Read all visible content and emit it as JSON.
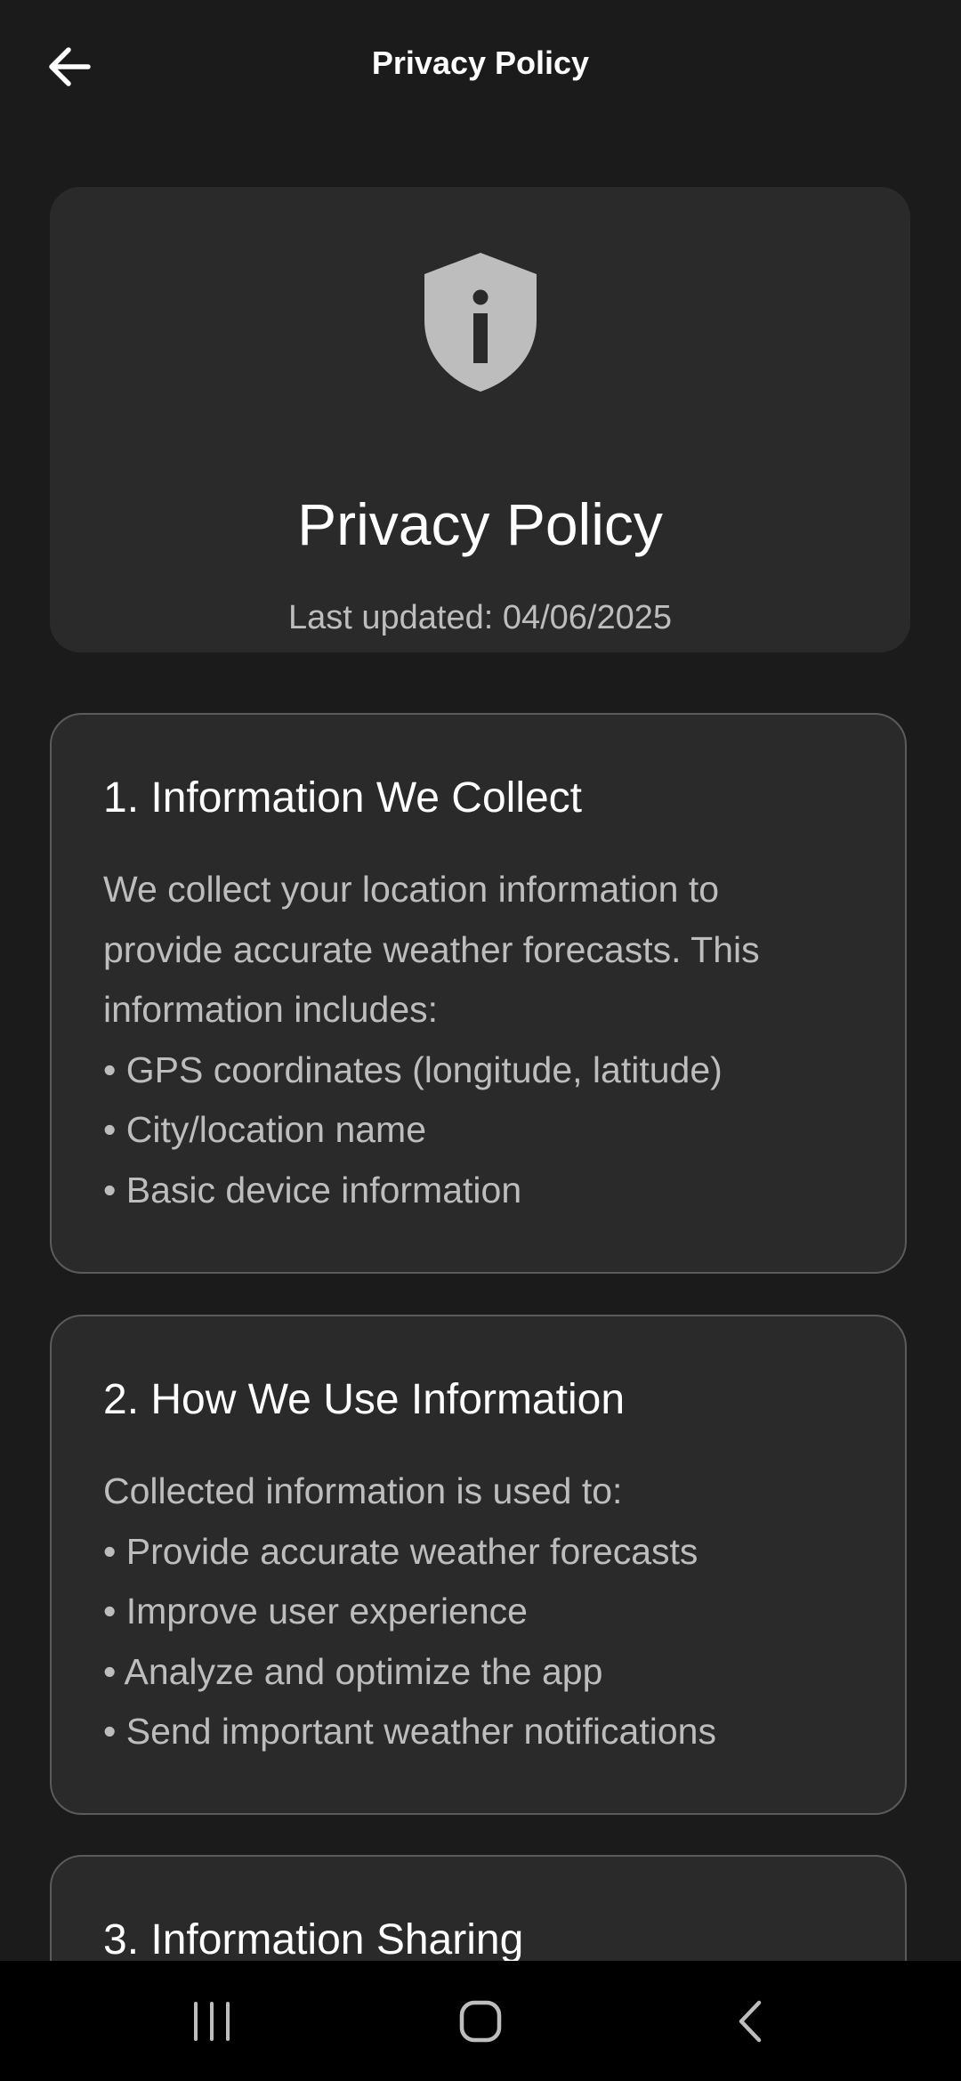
{
  "app_bar": {
    "title": "Privacy Policy",
    "back_icon": "arrow-left-icon"
  },
  "hero": {
    "icon": "shield-info-icon",
    "title": "Privacy Policy",
    "last_updated": "Last updated: 04/06/2025"
  },
  "sections": [
    {
      "title": "1. Information We Collect",
      "lines": [
        "We collect your location information to",
        "provide accurate weather forecasts. This",
        "information includes:",
        "• GPS coordinates (longitude, latitude)",
        "• City/location name",
        "• Basic device information"
      ]
    },
    {
      "title": "2. How We Use Information",
      "lines": [
        "Collected information is used to:",
        "• Provide accurate weather forecasts",
        "• Improve user experience",
        "• Analyze and optimize the app",
        "• Send important weather notifications"
      ]
    },
    {
      "title": "3. Information Sharing",
      "lines": []
    }
  ],
  "nav_bar": {
    "recents_icon": "recent-apps-icon",
    "home_icon": "home-icon",
    "back_icon": "back-chevron-icon"
  },
  "colors": {
    "background": "#1b1b1b",
    "card": "#2a2a2a",
    "card_border": "#5b5b5b",
    "text_primary": "#ffffff",
    "text_secondary": "#bdbdbd",
    "icon": "#bdbdbd",
    "nav_bar": "#000000"
  }
}
